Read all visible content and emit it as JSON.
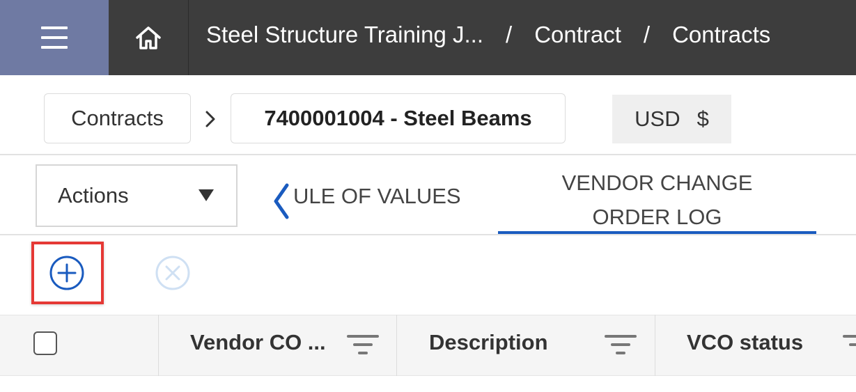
{
  "topbar": {
    "menu_icon": "hamburger-icon",
    "home_icon": "home-icon",
    "breadcrumb": [
      "Steel Structure Training J...",
      "Contract",
      "Contracts"
    ],
    "separator": "/"
  },
  "nav_path": {
    "contracts_label": "Contracts",
    "contract_label": "7400001004 - Steel Beams",
    "currency_code": "USD",
    "currency_symbol": "$"
  },
  "toolbar": {
    "actions_label": "Actions",
    "tabs": [
      {
        "label": "ULE OF VALUES",
        "active": false
      },
      {
        "label_line1": "VENDOR CHANGE",
        "label_line2": "ORDER LOG",
        "active": true
      }
    ],
    "add_icon": "add-circle-icon",
    "remove_icon": "remove-circle-icon"
  },
  "grid": {
    "columns": [
      "Vendor CO ...",
      "Description",
      "VCO status"
    ]
  },
  "colors": {
    "topbar_bg": "#3d3d3d",
    "menu_bg": "#6f7aa3",
    "accent_blue": "#1a5bbf",
    "highlight_red": "#e53935"
  }
}
